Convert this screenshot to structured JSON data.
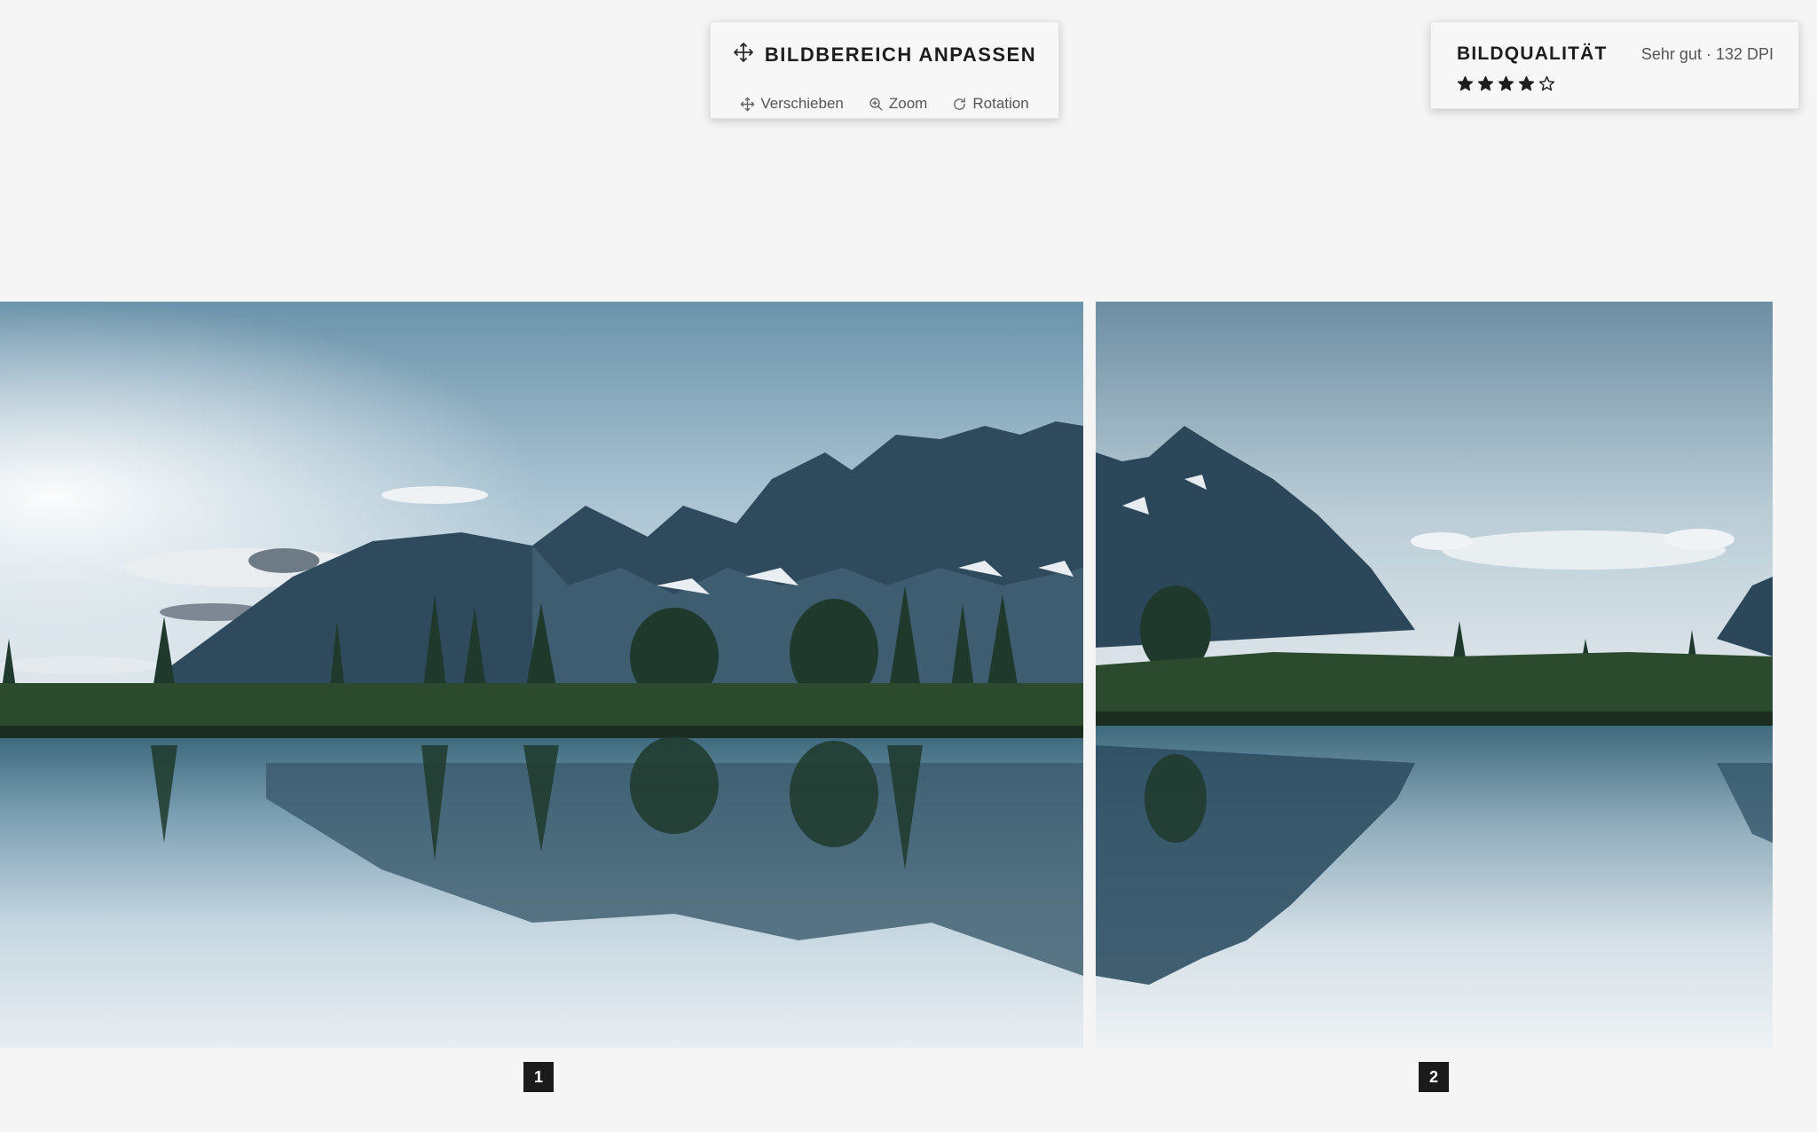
{
  "crop_panel": {
    "title": "BILDBEREICH ANPASSEN",
    "title_icon": "move-icon",
    "tools": [
      {
        "label": "Verschieben",
        "icon": "move-icon"
      },
      {
        "label": "Zoom",
        "icon": "zoom-in-icon"
      },
      {
        "label": "Rotation",
        "icon": "rotate-icon"
      }
    ]
  },
  "quality_panel": {
    "label": "BILDQUALITÄT",
    "value": "Sehr gut · 132 DPI",
    "rating": 4,
    "rating_max": 5
  },
  "panels": [
    {
      "number": "1"
    },
    {
      "number": "2"
    }
  ],
  "colors": {
    "background": "#f5f5f5",
    "badge": "#1b1b1b",
    "text_dark": "#1d1d1d",
    "text_muted": "#555555"
  }
}
